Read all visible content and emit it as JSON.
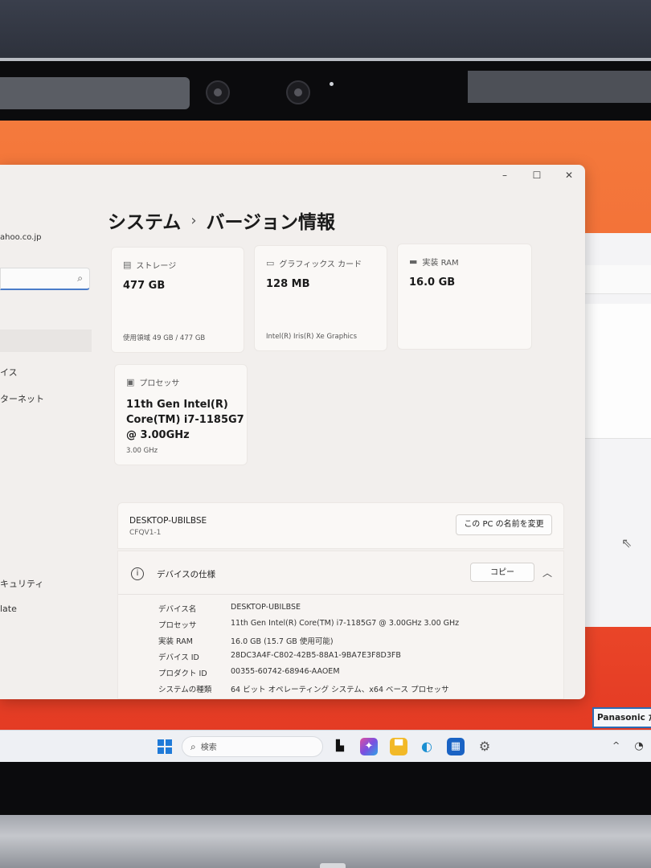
{
  "window": {
    "controls": {
      "minimize": "–",
      "maximize": "☐",
      "close": "✕"
    }
  },
  "sidebar": {
    "account_email": "ahoo.co.jp",
    "search_icon": "search-icon",
    "items": [
      {
        "label": "イス"
      },
      {
        "label": "ターネット"
      },
      {
        "label": "キュリティ"
      },
      {
        "label": "late"
      }
    ]
  },
  "breadcrumb": {
    "parent": "システム",
    "separator": "›",
    "current": "バージョン情報"
  },
  "cards": {
    "storage": {
      "caption": "ストレージ",
      "icon": "storage-icon",
      "value": "477 GB",
      "footer": "使用領域 49 GB / 477 GB"
    },
    "graphics": {
      "caption": "グラフィックス カード",
      "icon": "display-icon",
      "value": "128 MB",
      "footer": "Intel(R) Iris(R) Xe Graphics"
    },
    "ram": {
      "caption": "実装 RAM",
      "icon": "memory-icon",
      "value": "16.0 GB"
    },
    "processor": {
      "caption": "プロセッサ",
      "icon": "cpu-icon",
      "value": "11th Gen Intel(R) Core(TM) i7-1185G7 @ 3.00GHz",
      "footer": "3.00 GHz"
    }
  },
  "device_name_panel": {
    "pc_name": "DESKTOP-UBILBSE",
    "model": "CFQV1-1",
    "rename_button": "この PC の名前を変更"
  },
  "device_spec": {
    "title": "デバイスの仕様",
    "copy_button": "コピー",
    "chevron": "︿",
    "rows": [
      {
        "key": "デバイス名",
        "value": "DESKTOP-UBILBSE"
      },
      {
        "key": "プロセッサ",
        "value": "11th Gen Intel(R) Core(TM) i7-1185G7 @ 3.00GHz   3.00 GHz"
      },
      {
        "key": "実装 RAM",
        "value": "16.0 GB (15.7 GB 使用可能)"
      },
      {
        "key": "デバイス ID",
        "value": "28DC3A4F-C802-42B5-88A1-9BA7E3F8D3FB"
      },
      {
        "key": "プロダクト ID",
        "value": "00355-60742-68946-AAOEM"
      },
      {
        "key": "システムの種類",
        "value": "64 ビット オペレーティング システム、x64 ベース プロセッサ"
      }
    ]
  },
  "taskbar": {
    "search_placeholder": "検索",
    "tray_text": "^",
    "brand_label": "Panasonic た"
  }
}
